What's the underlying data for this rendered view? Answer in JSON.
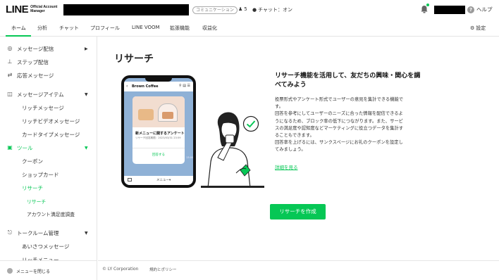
{
  "header": {
    "logo_main": "LINE",
    "logo_sub_1": "Official Account",
    "logo_sub_2": "Manager",
    "account_status": "コミュニケーション",
    "friends_count": "5",
    "chat_status": "チャット：オン",
    "help_label": "ヘルプ"
  },
  "nav": {
    "tabs": [
      {
        "label": "ホーム"
      },
      {
        "label": "分析"
      },
      {
        "label": "チャット"
      },
      {
        "label": "プロフィール"
      },
      {
        "label": "LINE VOOM"
      },
      {
        "label": "拡張機能"
      },
      {
        "label": "収益化"
      }
    ],
    "settings_label": "設定"
  },
  "sidebar": {
    "items": [
      {
        "label": "メッセージ配信"
      },
      {
        "label": "ステップ配信"
      },
      {
        "label": "応答メッセージ"
      },
      {
        "label": "メッセージアイテム"
      },
      {
        "label": "リッチメッセージ"
      },
      {
        "label": "リッチビデオメッセージ"
      },
      {
        "label": "カードタイプメッセージ"
      },
      {
        "label": "ツール"
      },
      {
        "label": "クーポン"
      },
      {
        "label": "ショップカード"
      },
      {
        "label": "リサーチ"
      },
      {
        "label": "リサーチ"
      },
      {
        "label": "アカウント満足度調査"
      },
      {
        "label": "トークルーム管理"
      },
      {
        "label": "あいさつメッセージ"
      },
      {
        "label": "リッチメニュー"
      }
    ],
    "collapse_label": "メニューを閉じる"
  },
  "main": {
    "page_title": "リサーチ",
    "phone": {
      "shop_name": "Brown Coffee",
      "card_title": "新メニューに関するアンケート",
      "card_meta": "リサーチ回答期限：2023/03/31 23:59",
      "card_link": "回答する",
      "time": "13:00",
      "menu_label": "メニュー▾"
    },
    "heading": "リサーチ機能を活用して、友だちの興味・関心を調べてみよう",
    "description_lines": [
      "投票形式やアンケート形式でユーザーの意見を集計できる機能で",
      "す。",
      "回答を参考にしてユーザーのニーズに合った情報を配信できるよ",
      "うになるため、ブロック率の低下につながります。また、サービ",
      "スの満足度や認知度などマーケティングに役立つデータを集計す",
      "ることもできます。",
      "回答率を上げるには、サンクスページにお礼のクーポンを設定し",
      "てみましょう。"
    ],
    "more_link": "詳細を見る",
    "create_button": "リサーチを作成"
  },
  "footer": {
    "copyright": "© LY Corporation",
    "terms": "規約とポリシー"
  },
  "colors": {
    "accent": "#06c755",
    "text": "#222222",
    "border": "#e5e5e5",
    "phone_bg": "#8fb1d6"
  }
}
